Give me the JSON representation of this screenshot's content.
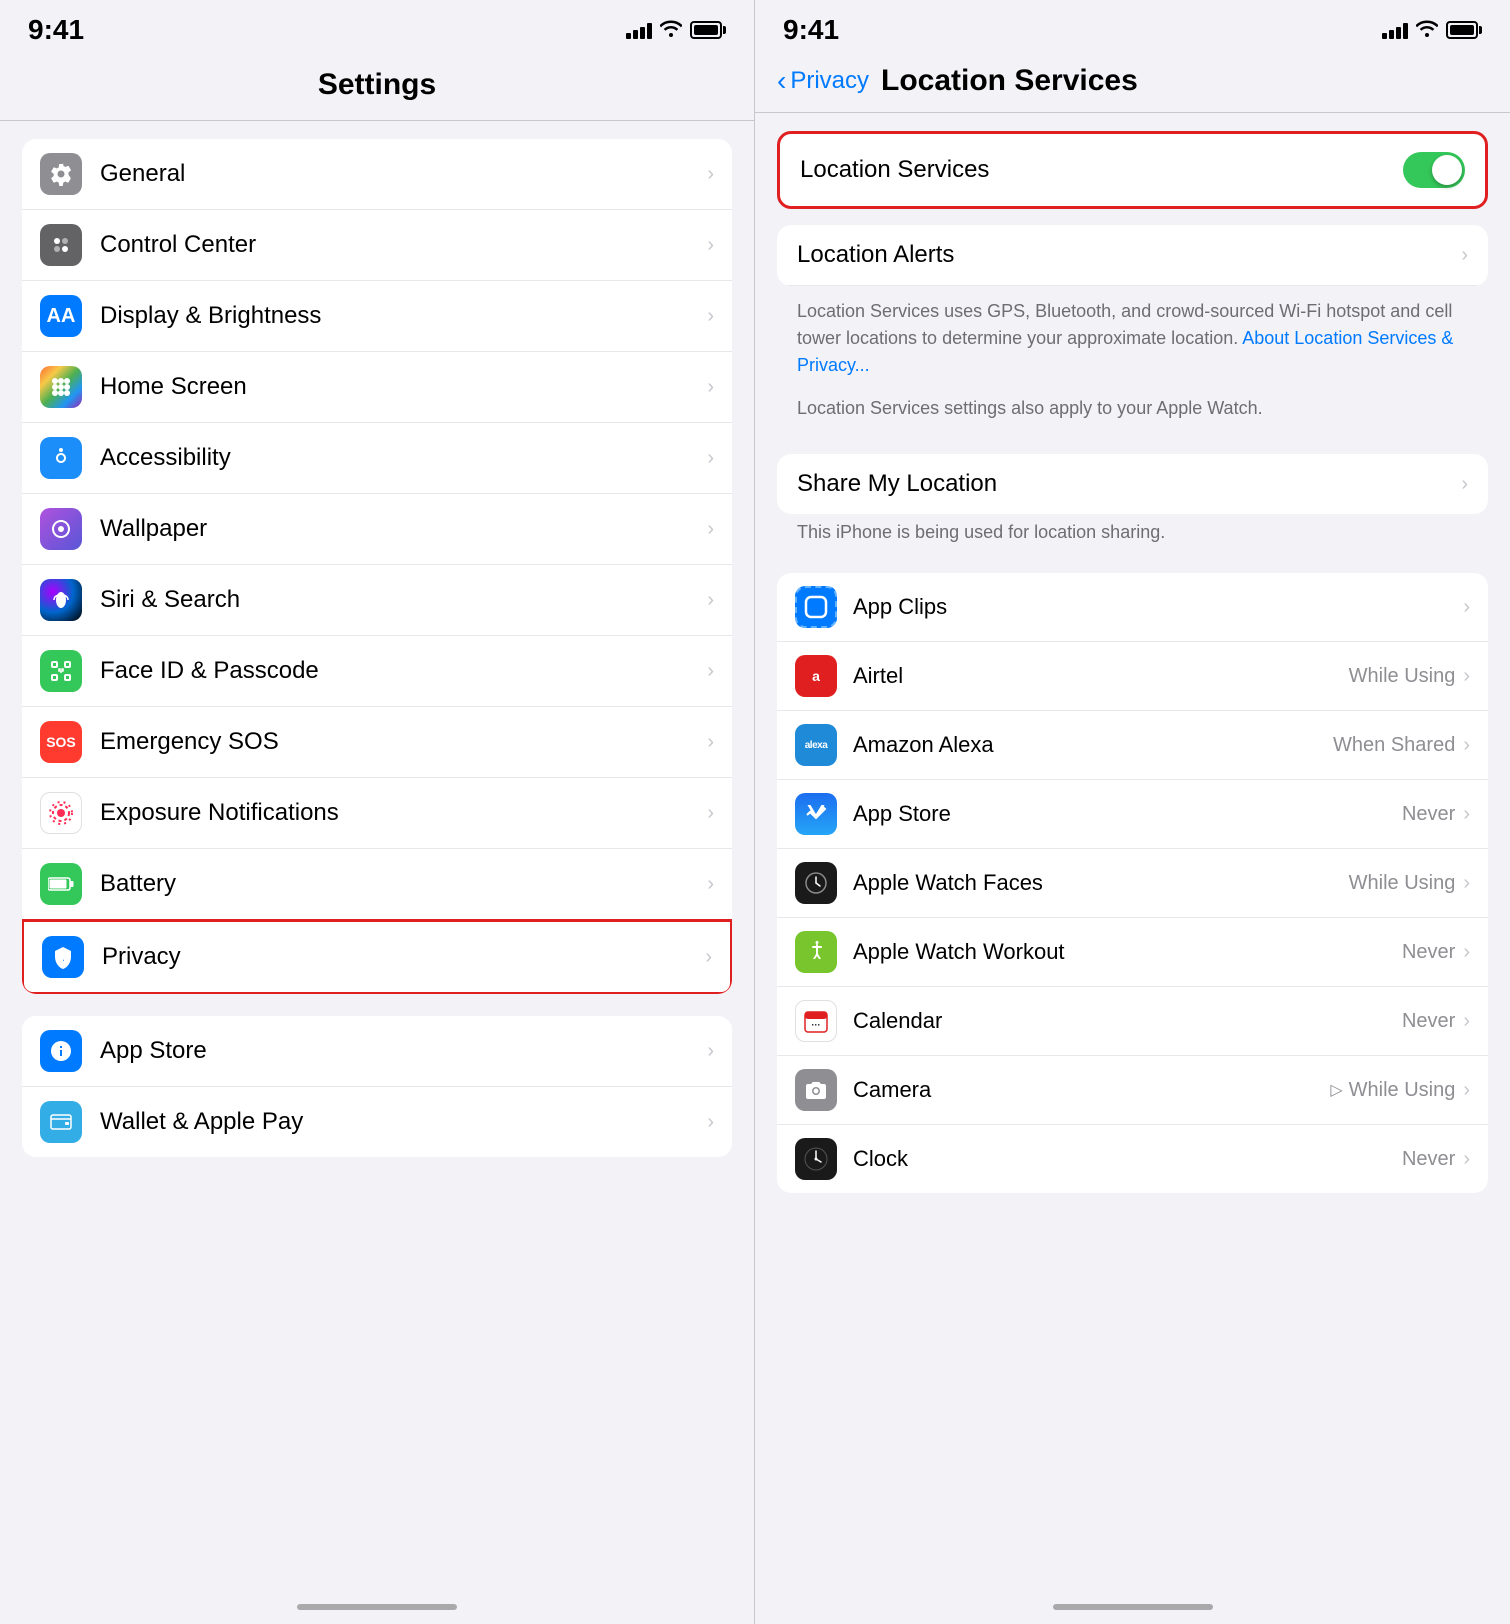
{
  "left": {
    "time": "9:41",
    "title": "Settings",
    "groups": [
      {
        "id": "group1",
        "highlighted": false,
        "items": [
          {
            "id": "general",
            "label": "General",
            "icon": "gear",
            "iconBg": "icon-gray"
          },
          {
            "id": "control-center",
            "label": "Control Center",
            "icon": "sliders",
            "iconBg": "icon-gray2"
          },
          {
            "id": "display-brightness",
            "label": "Display & Brightness",
            "icon": "AA",
            "iconBg": "icon-blue"
          },
          {
            "id": "home-screen",
            "label": "Home Screen",
            "icon": "grid",
            "iconBg": "icon-orange"
          },
          {
            "id": "accessibility",
            "label": "Accessibility",
            "icon": "accessibility",
            "iconBg": "icon-blue2"
          },
          {
            "id": "wallpaper",
            "label": "Wallpaper",
            "icon": "wallpaper",
            "iconBg": "icon-purple"
          },
          {
            "id": "siri-search",
            "label": "Siri & Search",
            "icon": "siri",
            "iconBg": "icon-siri"
          },
          {
            "id": "face-id",
            "label": "Face ID & Passcode",
            "icon": "face-id",
            "iconBg": "icon-green"
          },
          {
            "id": "emergency-sos",
            "label": "Emergency SOS",
            "icon": "sos",
            "iconBg": "icon-red"
          },
          {
            "id": "exposure",
            "label": "Exposure Notifications",
            "icon": "exposure",
            "iconBg": "icon-pink"
          },
          {
            "id": "battery",
            "label": "Battery",
            "icon": "battery",
            "iconBg": "icon-green"
          },
          {
            "id": "privacy",
            "label": "Privacy",
            "icon": "privacy",
            "iconBg": "icon-blue",
            "highlighted": true
          }
        ]
      },
      {
        "id": "group2",
        "highlighted": false,
        "items": [
          {
            "id": "app-store",
            "label": "App Store",
            "icon": "appstore",
            "iconBg": "icon-blue"
          },
          {
            "id": "wallet",
            "label": "Wallet & Apple Pay",
            "icon": "wallet",
            "iconBg": "icon-teal"
          }
        ]
      }
    ],
    "homeBar": true
  },
  "right": {
    "time": "9:41",
    "backLabel": "Privacy",
    "title": "Location Services",
    "locationServicesToggle": {
      "label": "Location Services",
      "enabled": true,
      "highlighted": true
    },
    "locationAlerts": {
      "label": "Location Alerts"
    },
    "descriptionText": "Location Services uses GPS, Bluetooth, and crowd-sourced Wi-Fi hotspot and cell tower locations to determine your approximate location.",
    "descriptionLink": "About Location Services & Privacy...",
    "watchText": "Location Services settings also apply to your Apple Watch.",
    "shareMyLocation": {
      "label": "Share My Location",
      "subText": "This iPhone is being used for location sharing."
    },
    "apps": [
      {
        "id": "app-clips",
        "name": "App Clips",
        "status": "",
        "icon": "appclips",
        "iconBg": "#007aff",
        "hasArrow": false
      },
      {
        "id": "airtel",
        "name": "Airtel",
        "status": "While Using",
        "icon": "airtel",
        "iconBg": "#e02020",
        "hasArrow": false
      },
      {
        "id": "amazon-alexa",
        "name": "Amazon Alexa",
        "status": "When Shared",
        "icon": "alexa",
        "iconBg": "#1f8ad8",
        "hasArrow": false
      },
      {
        "id": "app-store",
        "name": "App Store",
        "status": "Never",
        "icon": "appstore",
        "iconBg": "#1c6ef0",
        "hasArrow": false
      },
      {
        "id": "apple-watch-faces",
        "name": "Apple Watch Faces",
        "status": "While Using",
        "icon": "applewatch",
        "iconBg": "#1a1a1a",
        "hasArrow": false
      },
      {
        "id": "apple-watch-workout",
        "name": "Apple Watch Workout",
        "status": "Never",
        "icon": "workout",
        "iconBg": "#78c52d",
        "hasArrow": false
      },
      {
        "id": "calendar",
        "name": "Calendar",
        "status": "Never",
        "icon": "calendar",
        "iconBg": "#fff",
        "hasArrow": false
      },
      {
        "id": "camera",
        "name": "Camera",
        "status": "While Using",
        "icon": "camera",
        "iconBg": "#8e8e93",
        "hasArrow": false,
        "hasLocationArrow": true
      },
      {
        "id": "clock",
        "name": "Clock",
        "status": "Never",
        "icon": "clock",
        "iconBg": "#1a1a1a",
        "hasArrow": false
      }
    ],
    "homeBar": true
  }
}
